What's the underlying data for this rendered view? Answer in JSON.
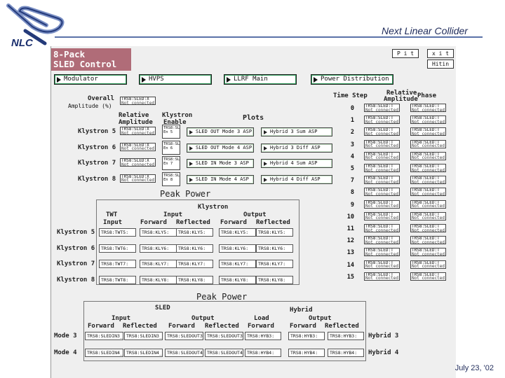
{
  "slide": {
    "title": "Next Linear Collider",
    "date": "July 23, '02",
    "logo_text": "NLC"
  },
  "window": {
    "title_line1": "8-Pack",
    "title_line2": "SLED Control",
    "btn_a": "P i t",
    "btn_b": "x i t",
    "btn_c": "Hitin"
  },
  "nav": [
    "Modulator",
    "HVPS",
    "LLRF Main",
    "Power Distribution"
  ],
  "overall": {
    "label_1": "Overall",
    "label_2": "Amplitude (%)",
    "pv_name": "TRS8:SLED:X",
    "pv_status": "Not connected"
  },
  "hdr": {
    "relative": "Relative",
    "amplitude": "Amplitude",
    "klystron": "Klystron",
    "enable": "Enable",
    "plots": "Plots"
  },
  "klystron_rows": [
    {
      "label": "Klystron 5",
      "amp": "TRS8:SLED:X",
      "amp_status": "Not connected",
      "enable_1": "TRS8:SLED",
      "enable_2": "En 5",
      "plot_a": "SLED OUT Mode 3 ASP",
      "plot_b": "Hybrid 3 Sum ASP"
    },
    {
      "label": "Klystron 6",
      "amp": "TRS8:SLED:X",
      "amp_status": "Not connected",
      "enable_1": "TRS8:SLED",
      "enable_2": "En 6",
      "plot_a": "SLED OUT Mode 4 ASP",
      "plot_b": "Hybrid 3 Diff ASP"
    },
    {
      "label": "Klystron 7",
      "amp": "TRS8:SLED:X",
      "amp_status": "Not connected",
      "enable_1": "TRS8:SLED",
      "enable_2": "En 7",
      "plot_a": "SLED IN Mode 3 ASP",
      "plot_b": "Hybrid 4 Sum ASP"
    },
    {
      "label": "Klystron 8",
      "amp": "TRS8:SLED:X",
      "amp_status": "Not connected",
      "enable_1": "TRS8:SLED",
      "enable_2": "En 8",
      "plot_a": "SLED IN Mode 4 ASP",
      "plot_b": "Hybrid 4 Diff ASP"
    }
  ],
  "timestep": {
    "ts_label": "Time Step",
    "rel_label_1": "Relative",
    "rel_label_2": "Amplitude",
    "phase_label": "Phase",
    "steps": [
      "0",
      "1",
      "2",
      "3",
      "4",
      "5",
      "7",
      "8",
      "9",
      "10",
      "11",
      "12",
      "13",
      "14",
      "15"
    ],
    "pv_name": "TRS8:SLED:T",
    "pv_status": "Not connected"
  },
  "peak1": {
    "title": "Peak Power",
    "klystron": "Klystron",
    "twt_1": "TWT",
    "twt_2": "Input",
    "input": "Input",
    "output": "Output",
    "forward": "Forward",
    "reflected": "Reflected",
    "forward2": "Forward",
    "reflected2": "Reflected",
    "rows": [
      {
        "label": "Klystron 5",
        "v": [
          "TRS8:TWT5:",
          "TRS8:KLY5:",
          "TRS8:KLY5:",
          "TRS8:KLY5:",
          "TRS8:KLY5:"
        ]
      },
      {
        "label": "Klystron 6",
        "v": [
          "TRS8:TWT6:",
          "TRS8:KLY6:",
          "TRS8:KLY6:",
          "TRS8:KLY6:",
          "TRS8:KLY6:"
        ]
      },
      {
        "label": "Klystron 7",
        "v": [
          "TRS8:TWT7:",
          "TRS8:KLY7:",
          "TRS8:KLY7:",
          "TRS8:KLY7:",
          "TRS8:KLY7:"
        ]
      },
      {
        "label": "Klystron 8",
        "v": [
          "TRS8:TWT8:",
          "TRS8:KLY8:",
          "TRS8:KLY8:",
          "TRS8:KLY8:",
          "TRS8:KLY8:"
        ]
      }
    ]
  },
  "peak2": {
    "title": "Peak Power",
    "sled": "SLED",
    "hybrid": "Hybrid",
    "input": "Input",
    "output": "Output",
    "load": "Load",
    "output2": "Output",
    "forward": "Forward",
    "reflected": "Reflected",
    "forward2": "Forward",
    "reflected2": "Reflected",
    "forward3": "Forward",
    "forward4": "Forward",
    "reflected3": "Reflected",
    "rows": [
      {
        "label": "Mode 3",
        "v": [
          "TRS8:SLEDIN3_F",
          "TRS8:SLEDIN3_R",
          "TRS8:SLEDOUT3_F",
          "TRS8:SLEDOUT3_R",
          "TRS8:HYB3:",
          "TRS8:HYB3:",
          "TRS8:HYB3:"
        ],
        "hyb": "Hybrid 3"
      },
      {
        "label": "Mode 4",
        "v": [
          "TRS8:SLEDIN4_F",
          "TRS8:SLEDIN4_R",
          "TRS8:SLEDOUT4_F",
          "TRS8:SLEDOUT4_R",
          "TRS8:HYB4:",
          "TRS8:HYB4:",
          "TRS8:HYB4:"
        ],
        "hyb": "Hybrid 4"
      }
    ]
  }
}
